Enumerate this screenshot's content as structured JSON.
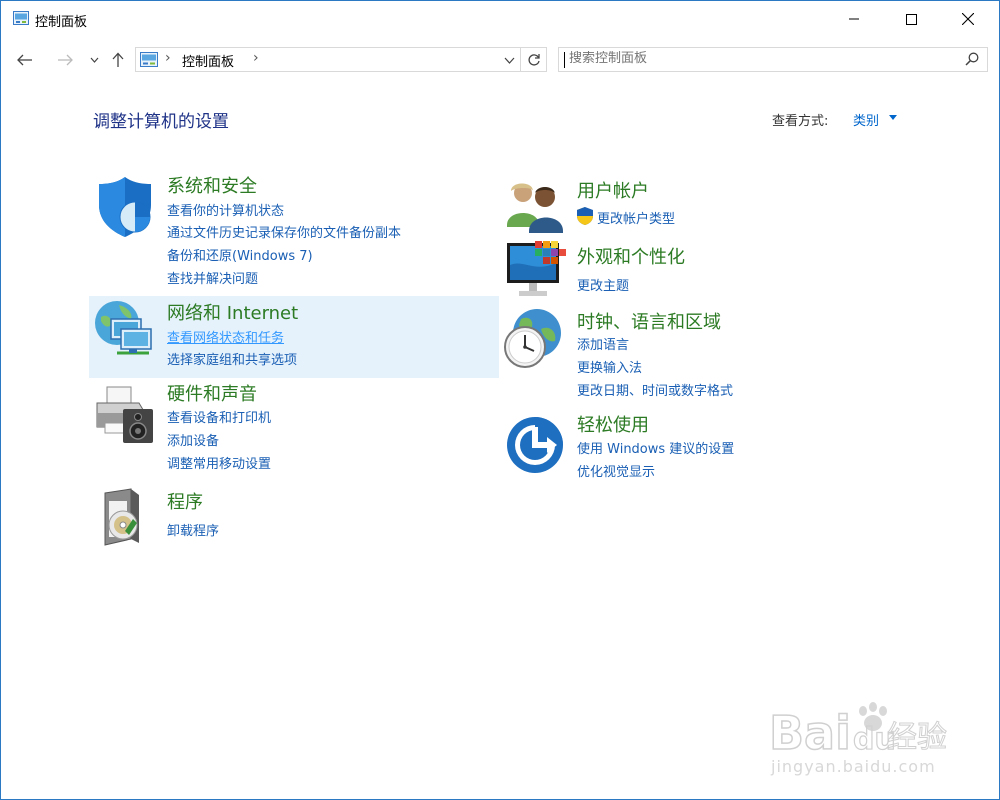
{
  "window": {
    "title": "控制面板"
  },
  "nav": {
    "address_text": "控制面板",
    "address_sep": "›",
    "search_placeholder": "搜索控制面板"
  },
  "header": {
    "page_title": "调整计算机的设置",
    "view_by_label": "查看方式:",
    "view_by_value": "类别"
  },
  "categories": {
    "system_security": {
      "title": "系统和安全",
      "links": [
        "查看你的计算机状态",
        "通过文件历史记录保存你的文件备份副本",
        "备份和还原(Windows 7)",
        "查找并解决问题"
      ]
    },
    "network": {
      "title": "网络和 Internet",
      "links": [
        "查看网络状态和任务",
        "选择家庭组和共享选项"
      ]
    },
    "hardware": {
      "title": "硬件和声音",
      "links": [
        "查看设备和打印机",
        "添加设备",
        "调整常用移动设置"
      ]
    },
    "programs": {
      "title": "程序",
      "links": [
        "卸载程序"
      ]
    },
    "user_accounts": {
      "title": "用户帐户",
      "links": [
        "更改帐户类型"
      ]
    },
    "appearance": {
      "title": "外观和个性化",
      "links": [
        "更改主题"
      ]
    },
    "clock_region": {
      "title": "时钟、语言和区域",
      "links": [
        "添加语言",
        "更换输入法",
        "更改日期、时间或数字格式"
      ]
    },
    "ease_access": {
      "title": "轻松使用",
      "links": [
        "使用 Windows 建议的设置",
        "优化视觉显示"
      ]
    }
  },
  "watermark": {
    "brand": "Bai",
    "brand2": "du",
    "cn": "经验",
    "url": "jingyan.baidu.com"
  },
  "colors": {
    "category_title": "#2c7b24",
    "link": "#1a5fb4",
    "page_title": "#1e3287",
    "highlight": "#e5f1fb"
  }
}
